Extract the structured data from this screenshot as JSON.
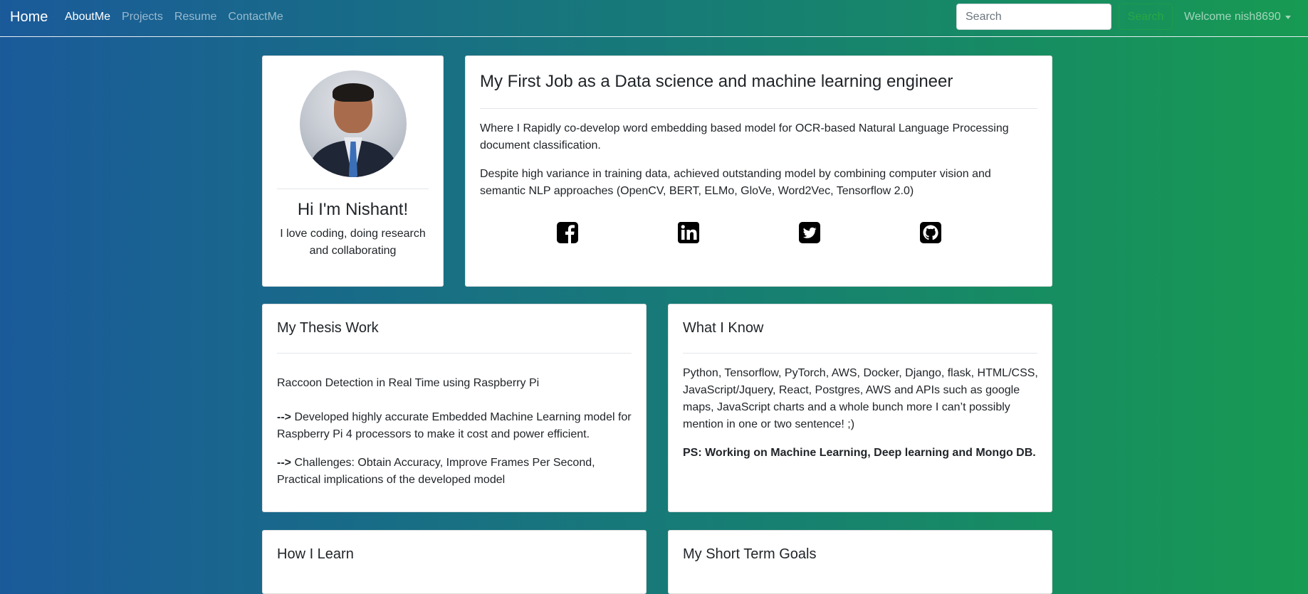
{
  "nav": {
    "brand": "Home",
    "links": [
      "AboutMe",
      "Projects",
      "Resume",
      "ContactMe"
    ],
    "search_placeholder": "Search",
    "search_button": "Search",
    "user_menu": "Welcome nish8690"
  },
  "profile": {
    "greeting": "Hi I'm Nishant!",
    "bio": "I love coding, doing research and collaborating"
  },
  "job": {
    "title": "My First Job as a Data science and machine learning engineer",
    "paragraph1": "Where I Rapidly co-develop word embedding based model for OCR-based Natural Language Processing document classification.",
    "paragraph2": "Despite high variance in training data, achieved outstanding model by combining computer vision and semantic NLP approaches (OpenCV, BERT, ELMo, GloVe, Word2Vec, Tensorflow 2.0)",
    "social_icons": [
      "facebook-icon",
      "linkedin-icon",
      "twitter-icon",
      "github-icon"
    ]
  },
  "thesis": {
    "title": "My Thesis Work",
    "line0": "Raccoon Detection in Real Time using Raspberry Pi",
    "arrow": "-->",
    "line1": "Developed highly accurate Embedded Machine Learning model for Raspberry Pi 4 processors to make it cost and power efficient.",
    "line2": "Challenges: Obtain Accuracy, Improve Frames Per Second, Practical implications of the developed model"
  },
  "know": {
    "title": "What I Know",
    "text": "Python, Tensorflow, PyTorch, AWS, Docker, Django, flask, HTML/CSS, JavaScript/Jquery, React, Postgres, AWS and APIs such as google maps, JavaScript charts and a whole bunch more I can’t possibly mention in one or two sentence! ;)",
    "ps": "PS: Working on Machine Learning, Deep learning and Mongo DB."
  },
  "learn": {
    "title": "How I Learn"
  },
  "goals": {
    "title": "My Short Term Goals"
  }
}
